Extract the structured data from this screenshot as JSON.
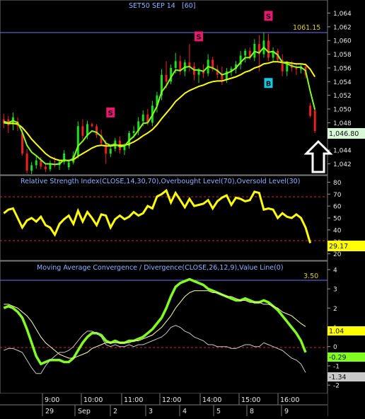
{
  "price_panel": {
    "title": "SET50 SEP 14",
    "interval": "[60]",
    "resistance_label": "1061.15",
    "last_price_label": "1,046.80",
    "axis_ticks": [
      "1,064",
      "1,062",
      "1,060",
      "1,058",
      "1,056",
      "1,054",
      "1,052",
      "1,050",
      "1,048",
      "1,044",
      "1,042"
    ],
    "signals": [
      {
        "letter": "S",
        "color": "#e8186c"
      },
      {
        "letter": "S",
        "color": "#e8186c"
      },
      {
        "letter": "S",
        "color": "#e8186c"
      },
      {
        "letter": "B",
        "color": "#18c8e0"
      }
    ]
  },
  "rsi_panel": {
    "title": "Relative Strength Index(CLOSE,14,30,70),Overbought Level(70),Oversold Level(30)",
    "axis_ticks": [
      "80",
      "70",
      "60",
      "50",
      "40",
      "30",
      "20"
    ],
    "value_label": "29.17"
  },
  "macd_panel": {
    "title": "Moving Average Convergence / Divergence(CLOSE,26,12,9),Value Line(0)",
    "axis_ticks": [
      "4",
      "3",
      "2",
      "1",
      "0",
      "-1",
      "-2"
    ],
    "value_line_label": "3.50",
    "signal_label": "1.04",
    "macd_label": "-0.29",
    "hist_label": "-1.34"
  },
  "time_axis": {
    "hours": [
      "9:00",
      "10:00",
      "11:00",
      "12:00",
      "14:00",
      "15:00",
      "16:00"
    ],
    "dates": [
      "29",
      "Sep",
      "2",
      "3",
      "4",
      "5",
      "8",
      "9"
    ]
  },
  "chart_data": [
    {
      "type": "candlestick",
      "title": "SET50 SEP 14 [60]",
      "y_range": [
        1040.5,
        1065.5
      ],
      "x_range": [
        0,
        69
      ],
      "resistance": 1061.15,
      "last_price": 1046.8,
      "candles": [
        {
          "o": 1048.5,
          "h": 1049.3,
          "l": 1047.2,
          "c": 1048.0
        },
        {
          "o": 1048.5,
          "h": 1049.0,
          "l": 1046.5,
          "c": 1047.6
        },
        {
          "o": 1047.8,
          "h": 1049.5,
          "l": 1046.9,
          "c": 1048.8
        },
        {
          "o": 1048.2,
          "h": 1048.8,
          "l": 1046.8,
          "c": 1047.5
        },
        {
          "o": 1046.5,
          "h": 1047.0,
          "l": 1043.2,
          "c": 1043.5
        },
        {
          "o": 1043.5,
          "h": 1044.2,
          "l": 1040.6,
          "c": 1041.0
        },
        {
          "o": 1041.0,
          "h": 1042.3,
          "l": 1040.5,
          "c": 1041.8
        },
        {
          "o": 1041.8,
          "h": 1043.2,
          "l": 1041.3,
          "c": 1042.5
        },
        {
          "o": 1042.5,
          "h": 1043.0,
          "l": 1041.2,
          "c": 1041.6
        },
        {
          "o": 1041.6,
          "h": 1042.0,
          "l": 1040.8,
          "c": 1041.2
        },
        {
          "o": 1041.2,
          "h": 1042.5,
          "l": 1040.9,
          "c": 1042.0
        },
        {
          "o": 1042.0,
          "h": 1043.0,
          "l": 1041.5,
          "c": 1041.8
        },
        {
          "o": 1041.8,
          "h": 1042.6,
          "l": 1041.1,
          "c": 1042.3
        },
        {
          "o": 1042.3,
          "h": 1044.0,
          "l": 1041.9,
          "c": 1043.5
        },
        {
          "o": 1041.5,
          "h": 1042.5,
          "l": 1041.1,
          "c": 1042.2
        },
        {
          "o": 1042.2,
          "h": 1043.8,
          "l": 1041.9,
          "c": 1043.2
        },
        {
          "o": 1043.2,
          "h": 1048.2,
          "l": 1042.8,
          "c": 1047.5
        },
        {
          "o": 1047.5,
          "h": 1048.5,
          "l": 1045.6,
          "c": 1046.1
        },
        {
          "o": 1046.1,
          "h": 1048.3,
          "l": 1045.6,
          "c": 1047.8
        },
        {
          "o": 1047.8,
          "h": 1048.0,
          "l": 1047.3,
          "c": 1047.5
        },
        {
          "o": 1047.5,
          "h": 1047.8,
          "l": 1045.8,
          "c": 1046.2
        },
        {
          "o": 1046.2,
          "h": 1047.0,
          "l": 1044.8,
          "c": 1045.0
        },
        {
          "o": 1045.0,
          "h": 1045.5,
          "l": 1042.0,
          "c": 1043.5
        },
        {
          "o": 1043.5,
          "h": 1044.8,
          "l": 1043.0,
          "c": 1044.2
        },
        {
          "o": 1044.2,
          "h": 1045.8,
          "l": 1043.8,
          "c": 1045.4
        },
        {
          "o": 1045.4,
          "h": 1046.0,
          "l": 1043.5,
          "c": 1044.0
        },
        {
          "o": 1044.0,
          "h": 1045.0,
          "l": 1043.3,
          "c": 1044.6
        },
        {
          "o": 1044.6,
          "h": 1046.8,
          "l": 1044.2,
          "c": 1046.5
        },
        {
          "o": 1046.5,
          "h": 1047.5,
          "l": 1045.8,
          "c": 1046.8
        },
        {
          "o": 1046.8,
          "h": 1048.8,
          "l": 1046.2,
          "c": 1048.2
        },
        {
          "o": 1048.2,
          "h": 1049.8,
          "l": 1047.5,
          "c": 1049.2
        },
        {
          "o": 1049.2,
          "h": 1050.0,
          "l": 1047.6,
          "c": 1048.0
        },
        {
          "o": 1048.0,
          "h": 1051.2,
          "l": 1047.5,
          "c": 1050.5
        },
        {
          "o": 1050.5,
          "h": 1052.5,
          "l": 1049.5,
          "c": 1052.0
        },
        {
          "o": 1052.0,
          "h": 1055.8,
          "l": 1051.3,
          "c": 1055.0
        },
        {
          "o": 1055.0,
          "h": 1057.0,
          "l": 1053.0,
          "c": 1054.0
        },
        {
          "o": 1054.0,
          "h": 1056.5,
          "l": 1053.6,
          "c": 1056.0
        },
        {
          "o": 1056.0,
          "h": 1058.2,
          "l": 1055.2,
          "c": 1057.0
        },
        {
          "o": 1057.0,
          "h": 1057.8,
          "l": 1055.0,
          "c": 1055.5
        },
        {
          "o": 1055.5,
          "h": 1057.2,
          "l": 1054.8,
          "c": 1056.8
        },
        {
          "o": 1056.8,
          "h": 1059.5,
          "l": 1055.5,
          "c": 1056.2
        },
        {
          "o": 1056.2,
          "h": 1056.8,
          "l": 1054.2,
          "c": 1055.0
        },
        {
          "o": 1055.0,
          "h": 1056.0,
          "l": 1053.8,
          "c": 1055.6
        },
        {
          "o": 1055.6,
          "h": 1056.5,
          "l": 1054.5,
          "c": 1055.2
        },
        {
          "o": 1055.2,
          "h": 1058.0,
          "l": 1054.8,
          "c": 1057.2
        },
        {
          "o": 1057.2,
          "h": 1057.6,
          "l": 1055.5,
          "c": 1055.8
        },
        {
          "o": 1055.8,
          "h": 1056.4,
          "l": 1054.5,
          "c": 1055.0
        },
        {
          "o": 1055.0,
          "h": 1056.2,
          "l": 1053.5,
          "c": 1054.3
        },
        {
          "o": 1054.3,
          "h": 1056.0,
          "l": 1053.8,
          "c": 1055.5
        },
        {
          "o": 1055.5,
          "h": 1056.2,
          "l": 1054.8,
          "c": 1055.9
        },
        {
          "o": 1055.9,
          "h": 1057.0,
          "l": 1055.2,
          "c": 1056.5
        },
        {
          "o": 1056.5,
          "h": 1058.5,
          "l": 1055.8,
          "c": 1057.8
        },
        {
          "o": 1057.8,
          "h": 1058.8,
          "l": 1056.8,
          "c": 1058.5
        },
        {
          "o": 1058.5,
          "h": 1059.0,
          "l": 1057.2,
          "c": 1057.5
        },
        {
          "o": 1057.5,
          "h": 1060.2,
          "l": 1057.0,
          "c": 1059.5
        },
        {
          "o": 1059.5,
          "h": 1060.8,
          "l": 1055.5,
          "c": 1058.0
        },
        {
          "o": 1058.0,
          "h": 1061.2,
          "l": 1057.5,
          "c": 1060.0
        },
        {
          "o": 1060.0,
          "h": 1061.0,
          "l": 1057.0,
          "c": 1057.5
        },
        {
          "o": 1057.5,
          "h": 1059.0,
          "l": 1056.8,
          "c": 1058.5
        },
        {
          "o": 1058.5,
          "h": 1058.8,
          "l": 1057.0,
          "c": 1057.2
        },
        {
          "o": 1057.2,
          "h": 1058.0,
          "l": 1054.8,
          "c": 1055.5
        },
        {
          "o": 1055.5,
          "h": 1057.0,
          "l": 1054.8,
          "c": 1056.5
        },
        {
          "o": 1056.5,
          "h": 1057.0,
          "l": 1055.5,
          "c": 1056.0
        },
        {
          "o": 1056.0,
          "h": 1056.6,
          "l": 1055.0,
          "c": 1055.8
        },
        {
          "o": 1055.8,
          "h": 1056.5,
          "l": 1055.2,
          "c": 1056.2
        },
        {
          "o": 1056.2,
          "h": 1056.6,
          "l": 1054.5,
          "c": 1055.0
        },
        {
          "o": 1050.5,
          "h": 1050.9,
          "l": 1048.8,
          "c": 1049.0
        },
        {
          "o": 1049.8,
          "h": 1050.2,
          "l": 1046.5,
          "c": 1046.8
        }
      ],
      "moving_averages": [
        {
          "color": "#ffff00",
          "values": [
            1048.0,
            1047.9,
            1047.9,
            1047.8,
            1047.3,
            1046.5,
            1045.6,
            1044.9,
            1044.2,
            1043.5,
            1043.0,
            1042.7,
            1042.5,
            1042.5,
            1042.5,
            1042.6,
            1043.1,
            1043.5,
            1043.9,
            1044.3,
            1044.6,
            1044.7,
            1044.6,
            1044.6,
            1044.7,
            1044.7,
            1044.7,
            1044.9,
            1045.2,
            1045.6,
            1046.1,
            1046.5,
            1047.0,
            1047.7,
            1048.6,
            1049.4,
            1050.2,
            1051.1,
            1051.7,
            1052.3,
            1052.7,
            1053.0,
            1053.3,
            1053.5,
            1053.8,
            1054.0,
            1054.1,
            1054.1,
            1054.3,
            1054.5,
            1054.7,
            1055.0,
            1055.4,
            1055.6,
            1056.0,
            1056.2,
            1056.6,
            1056.7,
            1056.9,
            1056.9,
            1056.8,
            1056.8,
            1056.7,
            1056.6,
            1056.6,
            1056.5,
            1055.8,
            1054.7
          ]
        },
        {
          "color": "#80ff20",
          "values": [
            1048.2,
            1048.0,
            1048.3,
            1048.0,
            1046.6,
            1044.7,
            1043.7,
            1043.2,
            1042.6,
            1042.0,
            1042.0,
            1041.9,
            1042.0,
            1042.6,
            1042.4,
            1042.8,
            1044.6,
            1045.3,
            1046.2,
            1046.8,
            1046.6,
            1046.0,
            1045.0,
            1044.7,
            1044.9,
            1044.5,
            1044.6,
            1045.4,
            1046.0,
            1046.9,
            1047.9,
            1048.0,
            1049.1,
            1050.4,
            1052.5,
            1053.4,
            1054.6,
            1055.7,
            1055.6,
            1056.1,
            1056.2,
            1055.7,
            1055.7,
            1055.5,
            1056.2,
            1056.0,
            1055.6,
            1055.0,
            1055.2,
            1055.5,
            1056.0,
            1056.8,
            1057.5,
            1057.5,
            1058.4,
            1058.2,
            1059.0,
            1058.3,
            1058.4,
            1057.9,
            1056.8,
            1056.6,
            1056.3,
            1056.1,
            1056.1,
            1055.6,
            1052.6,
            1049.9
          ]
        }
      ],
      "signals": [
        {
          "index": 23,
          "price": 1049.5,
          "letter": "S"
        },
        {
          "index": 42,
          "price": 1060.6,
          "letter": "S"
        },
        {
          "index": 57,
          "price": 1063.6,
          "letter": "S"
        },
        {
          "index": 57,
          "price": 1053.8,
          "letter": "B"
        }
      ]
    },
    {
      "type": "line",
      "title": "Relative Strength Index(CLOSE,14,30,70),Overbought Level(70),Oversold Level(30)",
      "y_range": [
        15,
        85
      ],
      "x_range": [
        0,
        69
      ],
      "levels": [
        70,
        30
      ],
      "series": [
        {
          "color": "#ffff00",
          "values": [
            54,
            57,
            58,
            50,
            42,
            48,
            50,
            47,
            51,
            44,
            42,
            36,
            45,
            49,
            52,
            45,
            56,
            47,
            55,
            50,
            44,
            53,
            52,
            42,
            49,
            52,
            49,
            51,
            55,
            52,
            54,
            60,
            58,
            68,
            70,
            73,
            63,
            71,
            65,
            59,
            66,
            60,
            61,
            62,
            65,
            58,
            64,
            67,
            69,
            61,
            67,
            66,
            64,
            65,
            72,
            71,
            57,
            58,
            57,
            50,
            54,
            51,
            50,
            53,
            50,
            42,
            29
          ]
        }
      ]
    },
    {
      "type": "line",
      "title": "Moving Average Convergence / Divergence(CLOSE,26,12,9),Value Line(0)",
      "y_range": [
        -2.4,
        4.4
      ],
      "x_range": [
        0,
        69
      ],
      "value_line": 0,
      "series": [
        {
          "color": "#80ff20",
          "values": [
            2.0,
            2.1,
            2.0,
            1.8,
            1.5,
            0.9,
            0.2,
            -0.5,
            -0.9,
            -0.8,
            -0.7,
            -0.7,
            -0.7,
            -0.8,
            -0.8,
            -0.6,
            -0.2,
            0.2,
            0.5,
            0.7,
            0.7,
            0.6,
            0.3,
            0.2,
            0.3,
            0.2,
            0.2,
            0.3,
            0.3,
            0.4,
            0.5,
            0.7,
            0.9,
            1.2,
            1.5,
            2.0,
            2.6,
            3.1,
            3.3,
            3.4,
            3.5,
            3.4,
            3.3,
            3.2,
            3.0,
            2.9,
            2.8,
            2.7,
            2.6,
            2.5,
            2.4,
            2.4,
            2.5,
            2.4,
            2.3,
            2.3,
            2.4,
            2.3,
            2.1,
            1.9,
            1.6,
            1.3,
            1.0,
            0.7,
            0.3,
            -0.3
          ]
        },
        {
          "color": "#ffffaa",
          "values": [
            2.2,
            2.2,
            2.1,
            2.0,
            1.8,
            1.6,
            1.3,
            0.9,
            0.5,
            0.2,
            0.0,
            -0.2,
            -0.4,
            -0.5,
            -0.6,
            -0.6,
            -0.5,
            -0.4,
            -0.3,
            -0.1,
            0.0,
            0.1,
            0.2,
            0.2,
            0.2,
            0.2,
            0.2,
            0.2,
            0.3,
            0.3,
            0.4,
            0.5,
            0.6,
            0.8,
            1.0,
            1.3,
            1.6,
            2.0,
            2.3,
            2.6,
            2.8,
            2.9,
            2.9,
            2.9,
            2.9,
            2.8,
            2.8,
            2.7,
            2.6,
            2.6,
            2.5,
            2.4,
            2.4,
            2.3,
            2.3,
            2.3,
            2.2,
            2.2,
            2.1,
            2.0,
            1.8,
            1.7,
            1.6,
            1.4,
            1.2,
            1.04
          ]
        },
        {
          "color": "#c8c8c8",
          "values": [
            -0.2,
            -0.1,
            -0.1,
            -0.2,
            -0.3,
            -0.7,
            -1.1,
            -1.4,
            -1.4,
            -1.0,
            -0.7,
            -0.5,
            -0.3,
            -0.3,
            -0.2,
            0.0,
            0.3,
            0.6,
            0.8,
            0.8,
            0.7,
            0.5,
            0.1,
            0.0,
            0.1,
            0.0,
            0.0,
            0.1,
            0.0,
            0.1,
            0.1,
            0.2,
            0.3,
            0.4,
            0.5,
            0.7,
            1.0,
            1.1,
            1.0,
            0.8,
            0.7,
            0.5,
            0.4,
            0.3,
            0.1,
            0.1,
            0.0,
            0.0,
            0.0,
            -0.1,
            -0.1,
            0.0,
            0.1,
            0.1,
            0.0,
            0.0,
            0.2,
            0.1,
            0.0,
            -0.1,
            -0.2,
            -0.4,
            -0.6,
            -0.7,
            -0.9,
            -1.34
          ]
        }
      ]
    }
  ]
}
